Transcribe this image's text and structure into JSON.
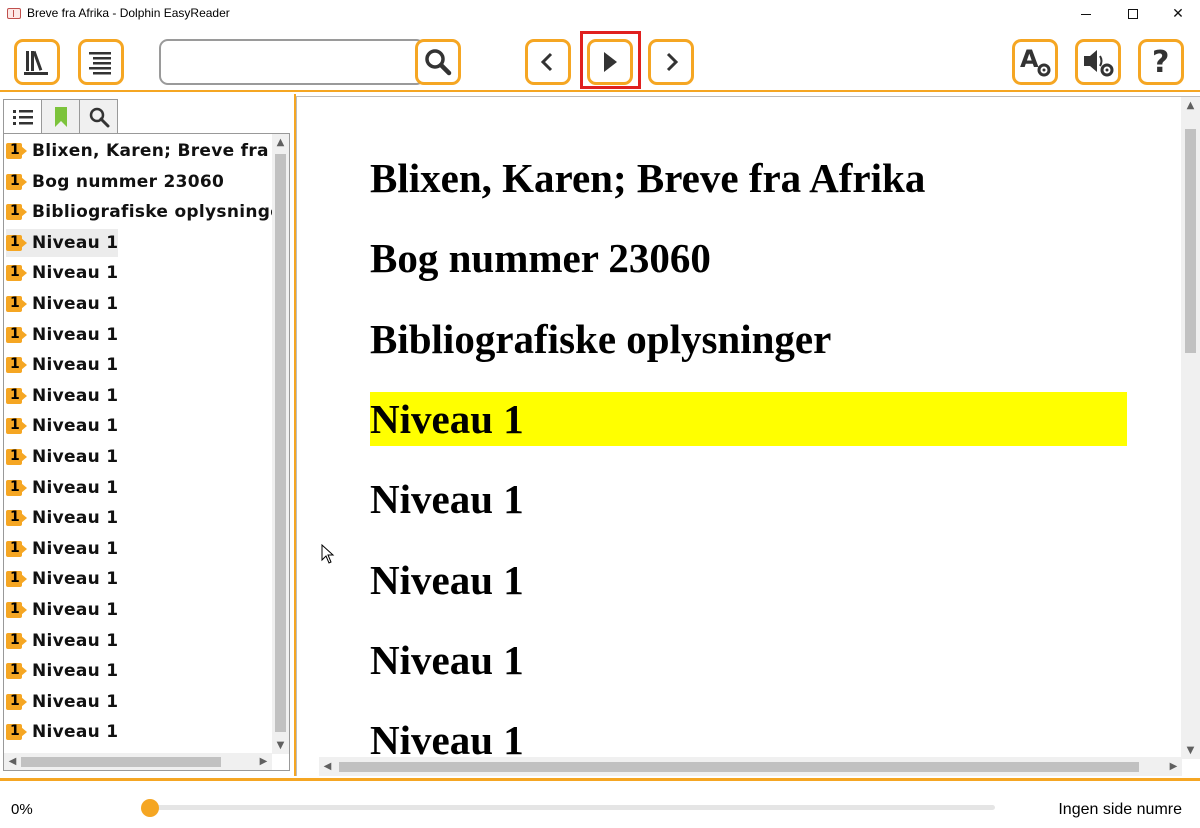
{
  "window": {
    "title": "Breve fra Afrika - Dolphin EasyReader",
    "controls": {
      "minimize": "minimize",
      "maximize": "maximize",
      "close": "✕"
    }
  },
  "toolbar": {
    "search_value": "",
    "search_placeholder": "",
    "icons": [
      "library-icon",
      "table-of-contents-icon",
      "search-icon",
      "previous-icon",
      "play-icon",
      "next-icon",
      "text-settings-icon",
      "voice-settings-icon",
      "help-icon"
    ],
    "accent_color": "#f5a623",
    "highlight_color": "#e0201f"
  },
  "left_panel": {
    "tabs": [
      "contents-tab",
      "bookmarks-tab",
      "search-tab"
    ],
    "items": [
      {
        "level": "1",
        "label": "Blixen, Karen; Breve fra Afrika"
      },
      {
        "level": "1",
        "label": "Bog nummer 23060"
      },
      {
        "level": "1",
        "label": "Bibliografiske oplysninger"
      },
      {
        "level": "1",
        "label": "Niveau 1"
      },
      {
        "level": "1",
        "label": "Niveau 1"
      },
      {
        "level": "1",
        "label": "Niveau 1"
      },
      {
        "level": "1",
        "label": "Niveau 1"
      },
      {
        "level": "1",
        "label": "Niveau 1"
      },
      {
        "level": "1",
        "label": "Niveau 1"
      },
      {
        "level": "1",
        "label": "Niveau 1"
      },
      {
        "level": "1",
        "label": "Niveau 1"
      },
      {
        "level": "1",
        "label": "Niveau 1"
      },
      {
        "level": "1",
        "label": "Niveau 1"
      },
      {
        "level": "1",
        "label": "Niveau 1"
      },
      {
        "level": "1",
        "label": "Niveau 1"
      },
      {
        "level": "1",
        "label": "Niveau 1"
      },
      {
        "level": "1",
        "label": "Niveau 1"
      },
      {
        "level": "1",
        "label": "Niveau 1"
      },
      {
        "level": "1",
        "label": "Niveau 1"
      },
      {
        "level": "1",
        "label": "Niveau 1"
      }
    ]
  },
  "reading_pane": {
    "lines": [
      "Blixen, Karen; Breve fra Afrika",
      "Bog nummer 23060",
      "Bibliografiske oplysninger",
      "Niveau 1",
      "Niveau 1",
      "Niveau 1",
      "Niveau 1",
      "Niveau 1"
    ],
    "highlighted_line": 3,
    "highlight_color": "#ffff00"
  },
  "status": {
    "progress_text": "0%",
    "progress_value": 0,
    "page_status": "Ingen side numre"
  }
}
